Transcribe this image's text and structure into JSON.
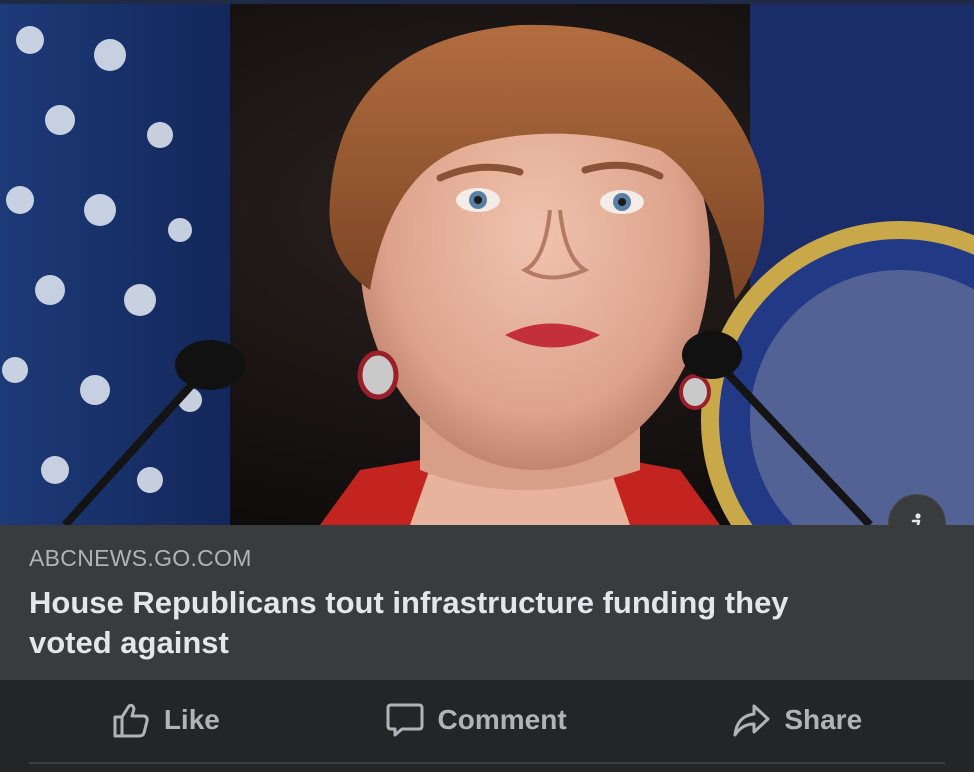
{
  "link_preview": {
    "image_description_icon": "photo-icon",
    "info_icon": "info-icon",
    "domain": "ABCNEWS.GO.COM",
    "headline": "House Republicans tout infrastructure funding they voted against"
  },
  "actions": {
    "like": {
      "label": "Like",
      "icon": "thumbs-up-icon"
    },
    "comment": {
      "label": "Comment",
      "icon": "comment-icon"
    },
    "share": {
      "label": "Share",
      "icon": "share-icon"
    }
  },
  "colors": {
    "background": "#242526",
    "meta_background": "#3a3b3c",
    "primary_text": "#e4e6eb",
    "secondary_text": "#b0b3b8"
  }
}
